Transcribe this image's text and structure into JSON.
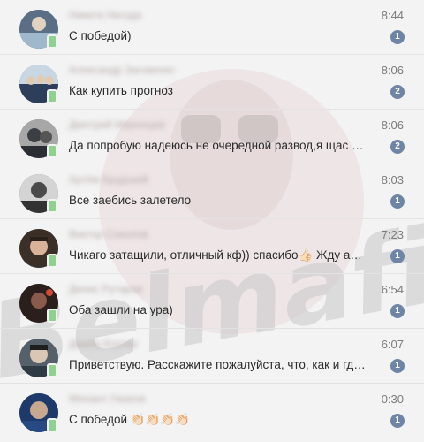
{
  "watermark": {
    "text": "Belmafia"
  },
  "dialogs": [
    {
      "name": "Никита Негода",
      "message": "С победой)",
      "time": "8:44",
      "unread": "1",
      "avatar_color": "#5a6f86",
      "avatar_accent": "#9fb8cc"
    },
    {
      "name": "Александр Заговенко",
      "message": "Как купить прогноз",
      "time": "8:06",
      "unread": "2",
      "avatar_color": "#2c3e5a",
      "avatar_accent": "#c9d7e5"
    },
    {
      "name": "Дмитрий Миронцев",
      "message": "Да попробую надеюсь не очередной развод,я щас в ком…",
      "time": "8:06",
      "unread": "2",
      "avatar_color": "#3b3f44",
      "avatar_accent": "#a7a7a7"
    },
    {
      "name": "Артём Брудский",
      "message": "Все заебись залетело",
      "time": "8:03",
      "unread": "1",
      "avatar_color": "#4a4a4a",
      "avatar_accent": "#d4d4d4"
    },
    {
      "name": "Виктор Соколов",
      "message": "Чикаго затащили, отличный кф)) спасибо👍🏻 Жду анонс …",
      "time": "7:23",
      "unread": "1",
      "avatar_color": "#3a3028",
      "avatar_accent": "#d8b39a"
    },
    {
      "name": "Денис Рутаров",
      "message": "Оба зашли на ура)",
      "time": "6:54",
      "unread": "1",
      "avatar_color": "#2a1f1c",
      "avatar_accent": "#8a5a4a"
    },
    {
      "name": "Джаба Коутев",
      "message": "Приветствую. Расскажите пожалуйста, что, как и где мн…",
      "time": "6:07",
      "unread": "1",
      "avatar_color": "#55606a",
      "avatar_accent": "#d9c6b4"
    },
    {
      "name": "Михаил Ужаков",
      "message": "С победой 👏🏻👏🏻👏🏻👏🏻",
      "time": "0:30",
      "unread": "1",
      "avatar_color": "#1e3a6a",
      "avatar_accent": "#c8a98f"
    }
  ]
}
